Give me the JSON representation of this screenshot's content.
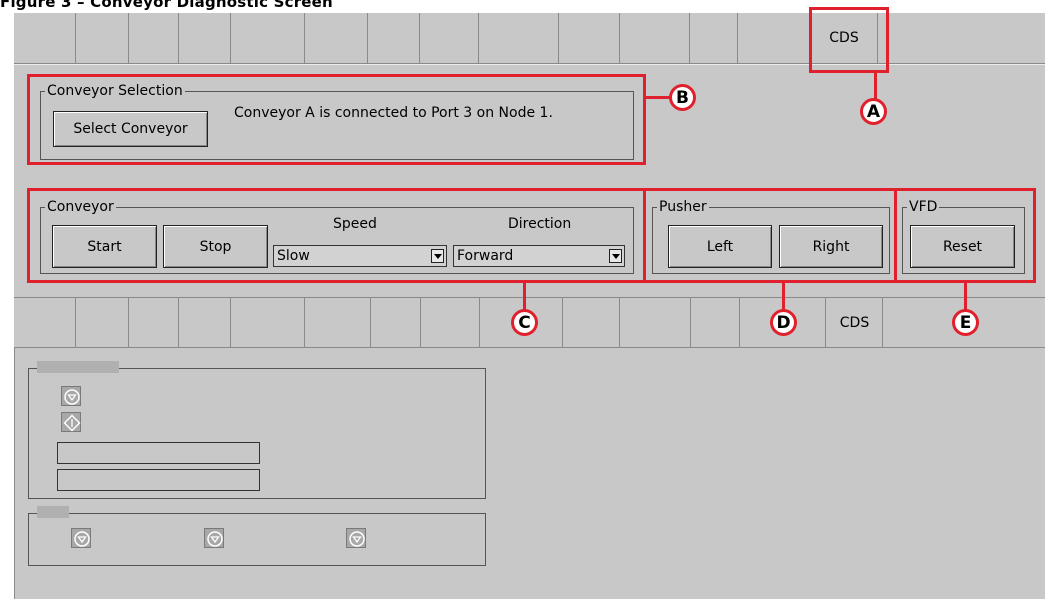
{
  "figure_title": "Figure 3 – Conveyor Diagnostic Screen",
  "tabs": {
    "active_label": "CDS"
  },
  "conveyor_selection": {
    "legend": "Conveyor Selection",
    "select_button": "Select Conveyor",
    "status_text": "Conveyor A is connected to Port 3 on Node 1."
  },
  "conveyor": {
    "legend": "Conveyor",
    "start_button": "Start",
    "stop_button": "Stop",
    "speed_label": "Speed",
    "speed_value": "Slow",
    "direction_label": "Direction",
    "direction_value": "Forward"
  },
  "pusher": {
    "legend": "Pusher",
    "left_button": "Left",
    "right_button": "Right"
  },
  "vfd": {
    "legend": "VFD",
    "reset_button": "Reset"
  },
  "callouts": {
    "a": "A",
    "b": "B",
    "c": "C",
    "d": "D",
    "e": "E"
  },
  "colors": {
    "highlight": "#e0202c",
    "panel": "#c8c8c8"
  },
  "icons": [
    "stop-circle-icon",
    "start-diamond-icon"
  ]
}
